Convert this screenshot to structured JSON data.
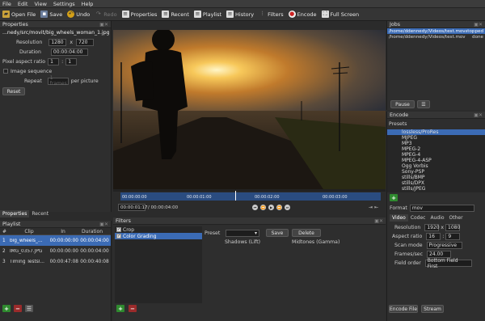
{
  "menu": [
    "File",
    "Edit",
    "View",
    "Settings",
    "Help"
  ],
  "toolbar": {
    "open": "Open File",
    "save": "Save",
    "undo": "Undo",
    "redo": "Redo",
    "properties": "Properties",
    "recent": "Recent",
    "playlist": "Playlist",
    "history": "History",
    "filters": "Filters",
    "encode": "Encode",
    "fullscreen": "Full Screen"
  },
  "properties": {
    "title": "Properties",
    "path": "...nedy/src/movit/big_wheels_woman_1.jpg",
    "resolution_label": "Resolution",
    "res_w": "1280",
    "res_x": "x",
    "res_h": "720",
    "duration_label": "Duration",
    "duration": "00:00:04:00",
    "par_label": "Pixel aspect ratio",
    "par_a": "1",
    "par_b": "1",
    "imgseq_label": "Image sequence",
    "repeat_label": "Repeat",
    "repeat_value": "1 frames",
    "per_picture": "per picture",
    "reset": "Reset",
    "tab_properties": "Properties",
    "tab_recent": "Recent"
  },
  "playlist": {
    "title": "Playlist",
    "headers": [
      "#",
      "Clip",
      "In",
      "Duration"
    ],
    "rows": [
      {
        "n": "1",
        "clip": "big_wheels_...",
        "in": "00:00:00:00",
        "dur": "00:00:04:00"
      },
      {
        "n": "2",
        "clip": "IMG_0357.JPG",
        "in": "00:00:00:00",
        "dur": "00:00:04:00"
      },
      {
        "n": "3",
        "clip": "Timing Testsl...",
        "in": "00:00:47:08",
        "dur": "00:00:40:08"
      }
    ],
    "plus": "+",
    "minus": "−",
    "menu": "☰"
  },
  "timeline": {
    "ticks": [
      "00:00:00:00",
      "00:00:01:00",
      "00:00:02:00",
      "00:00:03:00"
    ],
    "position": "00:00:01:17",
    "total": "/ 00:00:04:00",
    "playhead_fraction": 0.44
  },
  "filters": {
    "title": "Filters",
    "items": [
      "Crop",
      "Color Grading"
    ],
    "preset_label": "Preset",
    "save": "Save",
    "delete": "Delete",
    "shadows": "Shadows (Lift)",
    "midtones": "Midtones (Gamma)",
    "plus": "+",
    "minus": "−"
  },
  "jobs": {
    "title": "Jobs",
    "rows": [
      {
        "path": "/home/ddennedy/Videos/test.mov",
        "status": "stopped"
      },
      {
        "path": "/home/ddennedy/Videos/test.mov",
        "status": "done"
      }
    ],
    "pause": "Pause",
    "menu": "☰"
  },
  "encode": {
    "title": "Encode",
    "presets_label": "Presets",
    "presets": [
      "lossless/ProRes",
      "MJPEG",
      "MP3",
      "MPEG-2",
      "MPEG-4",
      "MPEG-4-ASP",
      "Ogg Vorbis",
      "Sony-PSP",
      "stills/BMP",
      "stills/DPX",
      "stills/JPEG"
    ],
    "format_label": "Format",
    "format": "mov",
    "tabs": [
      "Video",
      "Codec",
      "Audio",
      "Other"
    ],
    "resolution_label": "Resolution",
    "res_w": "1920",
    "res_h": "1080",
    "aspect_label": "Aspect ratio",
    "asp_a": "16",
    "asp_b": "9",
    "scan_label": "Scan mode",
    "scan": "Progressive",
    "fps_label": "Frames/sec",
    "fps": "24.00",
    "field_label": "Field order",
    "field": "Bottom Field First",
    "encode_file": "Encode File",
    "stream": "Stream",
    "plus": "+"
  },
  "colors": {
    "accent": "#3b6bb5",
    "bg": "#2b2b2b",
    "panel": "#353535"
  }
}
